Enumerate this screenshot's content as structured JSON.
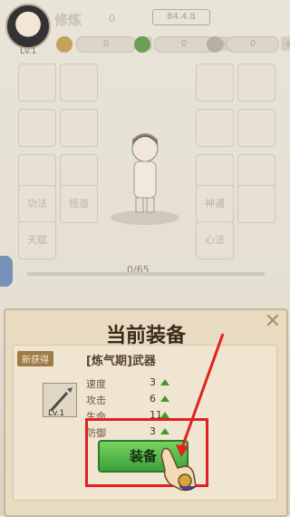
{
  "player": {
    "level": "Lv.1",
    "name": "修炼",
    "name_count": "0",
    "id_text": "84.4.8"
  },
  "resources": [
    {
      "name": "coin",
      "value": "0",
      "color": "#c5a25b",
      "icon": "swirl-icon"
    },
    {
      "name": "jade",
      "value": "0",
      "color": "#6b9d52",
      "icon": "jade-icon"
    },
    {
      "name": "scroll",
      "value": "0",
      "color": "#b7b0a2",
      "icon": "scroll-icon"
    }
  ],
  "grid_labels": {
    "left": [
      "",
      "",
      "",
      "",
      "",
      "",
      "功法",
      "悟道",
      "天赋"
    ],
    "right": [
      "",
      "",
      "",
      "",
      "",
      "",
      "神通",
      "",
      "心法"
    ]
  },
  "progress": {
    "label": "0/65",
    "fraction": 0.0
  },
  "dialog": {
    "title": "当前装备",
    "new_tag": "新获得",
    "weapon_name": "[炼气期]武器",
    "weapon_level": "Lv.1",
    "stats": [
      {
        "label": "速度",
        "value": "3"
      },
      {
        "label": "攻击",
        "value": "6"
      },
      {
        "label": "生命",
        "value": "11"
      },
      {
        "label": "防御",
        "value": "3"
      }
    ],
    "equip_label": "装备"
  }
}
